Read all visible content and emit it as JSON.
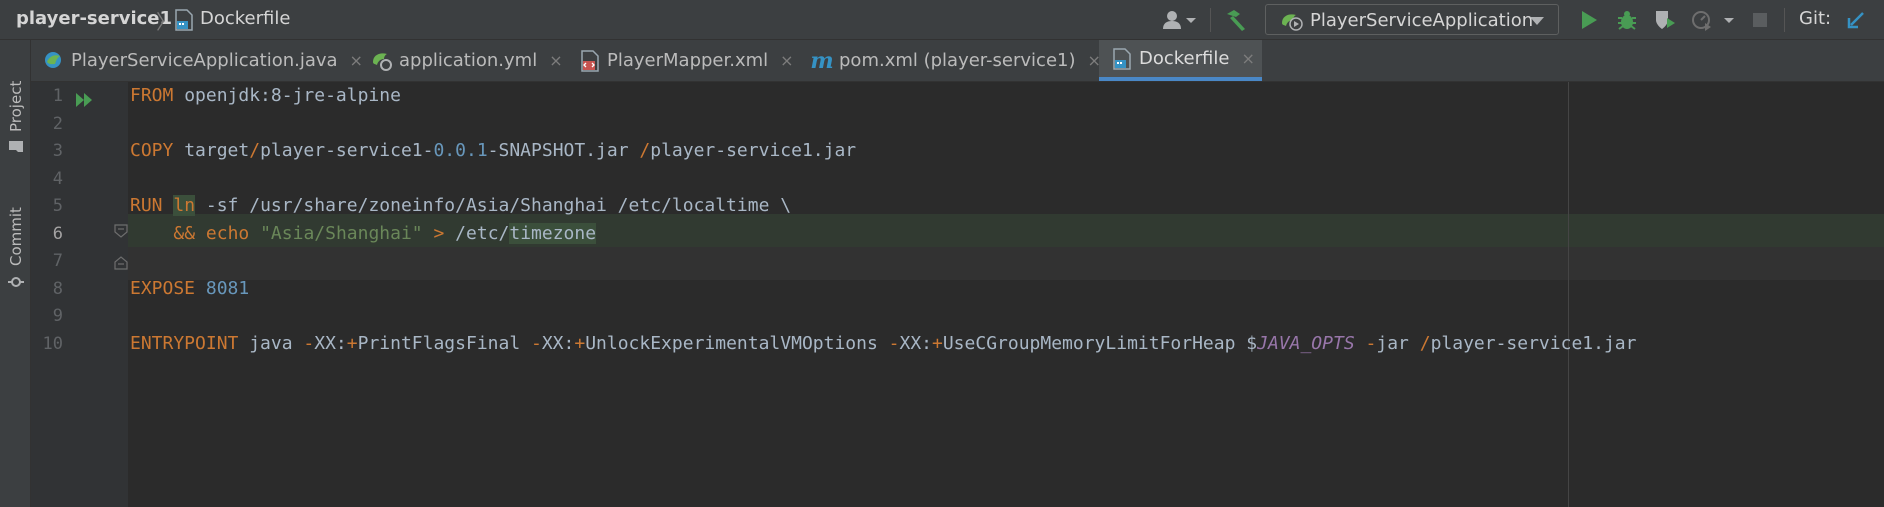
{
  "navbar": {
    "project": "player-service1",
    "current_file": "Dockerfile",
    "run_config": "PlayerServiceApplication",
    "git_label": "Git:"
  },
  "toolstrip": {
    "project_label": "Project",
    "commit_label": "Commit"
  },
  "tabs": [
    {
      "label": "PlayerServiceApplication.java",
      "icon": "spring-boot-icon",
      "active": false
    },
    {
      "label": "application.yml",
      "icon": "spring-config-icon",
      "active": false
    },
    {
      "label": "PlayerMapper.xml",
      "icon": "xml-file-icon",
      "active": false
    },
    {
      "label": "pom.xml (player-service1)",
      "icon": "maven-icon",
      "active": false
    },
    {
      "label": "Dockerfile",
      "icon": "docker-file-icon",
      "active": true
    }
  ],
  "tab_close_glyph": "×",
  "editor": {
    "line_numbers": [
      "1",
      "2",
      "3",
      "4",
      "5",
      "6",
      "7",
      "8",
      "9",
      "10"
    ],
    "current_line": 6,
    "lines": [
      [
        {
          "t": "FROM",
          "c": "kw"
        },
        {
          "t": " openjdk:8-jre-alpine"
        }
      ],
      [],
      [
        {
          "t": "COPY",
          "c": "kw"
        },
        {
          "t": " target"
        },
        {
          "t": "/",
          "c": "kw"
        },
        {
          "t": "player-service1-"
        },
        {
          "t": "0",
          "c": "num"
        },
        {
          "t": ".",
          "c": "num"
        },
        {
          "t": "0",
          "c": "num"
        },
        {
          "t": ".",
          "c": "num"
        },
        {
          "t": "1",
          "c": "num"
        },
        {
          "t": "-SNAPSHOT.jar "
        },
        {
          "t": "/",
          "c": "kw"
        },
        {
          "t": "player-service1.jar"
        }
      ],
      [],
      [
        {
          "t": "RUN",
          "c": "kw"
        },
        {
          "t": " "
        },
        {
          "t": "ln",
          "c": "kw word-hl"
        },
        {
          "t": " -sf /usr/share/zoneinfo/Asia/Shanghai /etc/localtime \\"
        }
      ],
      [
        {
          "t": "    "
        },
        {
          "t": "&&",
          "c": "kw"
        },
        {
          "t": " "
        },
        {
          "t": "echo",
          "c": "kw"
        },
        {
          "t": " "
        },
        {
          "t": "\"Asia/Shanghai\"",
          "c": "str"
        },
        {
          "t": " "
        },
        {
          "t": ">",
          "c": "kw"
        },
        {
          "t": " /etc/"
        },
        {
          "t": "timezone",
          "c": "word-hl"
        }
      ],
      [],
      [
        {
          "t": "EXPOSE",
          "c": "kw"
        },
        {
          "t": " "
        },
        {
          "t": "8081",
          "c": "num"
        }
      ],
      [],
      [
        {
          "t": "ENTRYPOINT",
          "c": "kw"
        },
        {
          "t": " java "
        },
        {
          "t": "-",
          "c": "kw"
        },
        {
          "t": "XX:"
        },
        {
          "t": "+",
          "c": "kw"
        },
        {
          "t": "PrintFlagsFinal "
        },
        {
          "t": "-",
          "c": "kw"
        },
        {
          "t": "XX:"
        },
        {
          "t": "+",
          "c": "kw"
        },
        {
          "t": "UnlockExperimentalVMOptions "
        },
        {
          "t": "-",
          "c": "kw"
        },
        {
          "t": "XX:"
        },
        {
          "t": "+",
          "c": "kw"
        },
        {
          "t": "UseCGroupMemoryLimitForHeap "
        },
        {
          "t": "$"
        },
        {
          "t": "JAVA_OPTS",
          "c": "var"
        },
        {
          "t": " "
        },
        {
          "t": "-",
          "c": "kw"
        },
        {
          "t": "jar "
        },
        {
          "t": "/",
          "c": "kw"
        },
        {
          "t": "player-service1.jar"
        }
      ]
    ]
  },
  "colors": {
    "keyword": "#cc7832",
    "number": "#6897bb",
    "string": "#6a8759",
    "variable": "#9876aa",
    "accent": "#4a88c7",
    "run_green": "#499c54"
  }
}
